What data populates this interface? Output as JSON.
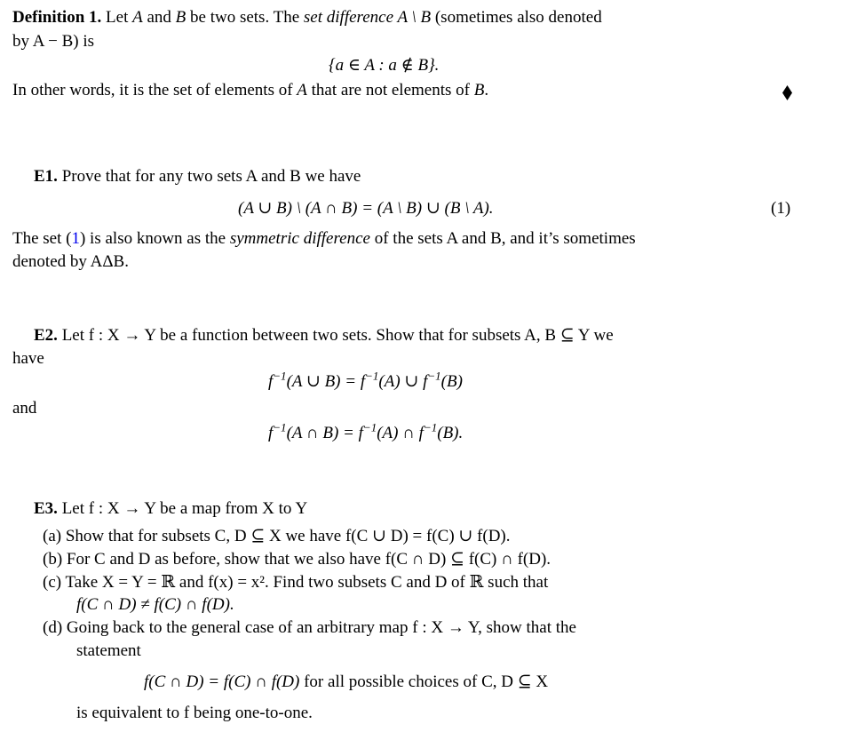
{
  "definition": {
    "label": "Definition 1.",
    "line1_a": "Let ",
    "A": "A",
    "and": " and ",
    "B": "B",
    "line1_b": " be two sets. The ",
    "term": "set difference",
    "setdiff": " A \\ B ",
    "line1_c": "(sometimes also denoted",
    "line2": "by A − B) is",
    "formula": "{a ∈ A :  a ∉ B}.",
    "line3_a": "In other words, it is the set of elements of ",
    "line3_b": " that are not elements of ",
    "line3_end": "."
  },
  "e1": {
    "label": "E1.",
    "intro": "Prove that for any two sets A and B we have",
    "formula": "(A ∪ B) \\ (A ∩ B) = (A \\ B) ∪ (B \\ A).",
    "eq_number": "(1)",
    "note_a": "The set (",
    "note_ref": "1",
    "note_b": ") is also known as the ",
    "term": "symmetric difference",
    "note_c": " of the sets A and B, and it’s sometimes",
    "note_line2": "denoted by AΔB."
  },
  "e2": {
    "label": "E2.",
    "intro_line1": "Let f : X → Y be a function between two sets. Show that for subsets A, B ⊆ Y we",
    "intro_line2": "have",
    "formula1_pre": "f",
    "formula1_post": "(A ∪ B) = f",
    "formula1_mid": "(A) ∪ f",
    "formula1_end": "(B)",
    "superscript": "−1",
    "and": "and",
    "formula2_post": "(A ∩ B) = f",
    "formula2_mid": "(A) ∩ f",
    "formula2_end": "(B)."
  },
  "e3": {
    "label": "E3.",
    "intro": "Let f : X → Y be a map from X to Y",
    "items": [
      {
        "marker": "(a)",
        "text": "Show that for subsets C, D ⊆ X we have f(C ∪ D) = f(C) ∪ f(D)."
      },
      {
        "marker": "(b)",
        "text": "For C and D as before, show that we also have f(C ∩ D) ⊆ f(C) ∩ f(D)."
      },
      {
        "marker": "(c)",
        "text": "Take X = Y = ℝ and f(x) = x². Find two subsets C and D of ℝ such that",
        "text2": "f(C ∩ D) ≠ f(C) ∩ f(D)."
      },
      {
        "marker": "(d)",
        "text": "Going back to the general case of an arbitrary map f : X → Y, show that the",
        "text2": "statement"
      }
    ],
    "formula_d": "f(C ∩ D) = f(C) ∩ f(D)",
    "formula_d_tail": " for all possible choices of C, D ⊆ X",
    "conclusion": "is equivalent to f being one-to-one."
  },
  "icons": {
    "end_of_definition": "diamond-icon"
  }
}
